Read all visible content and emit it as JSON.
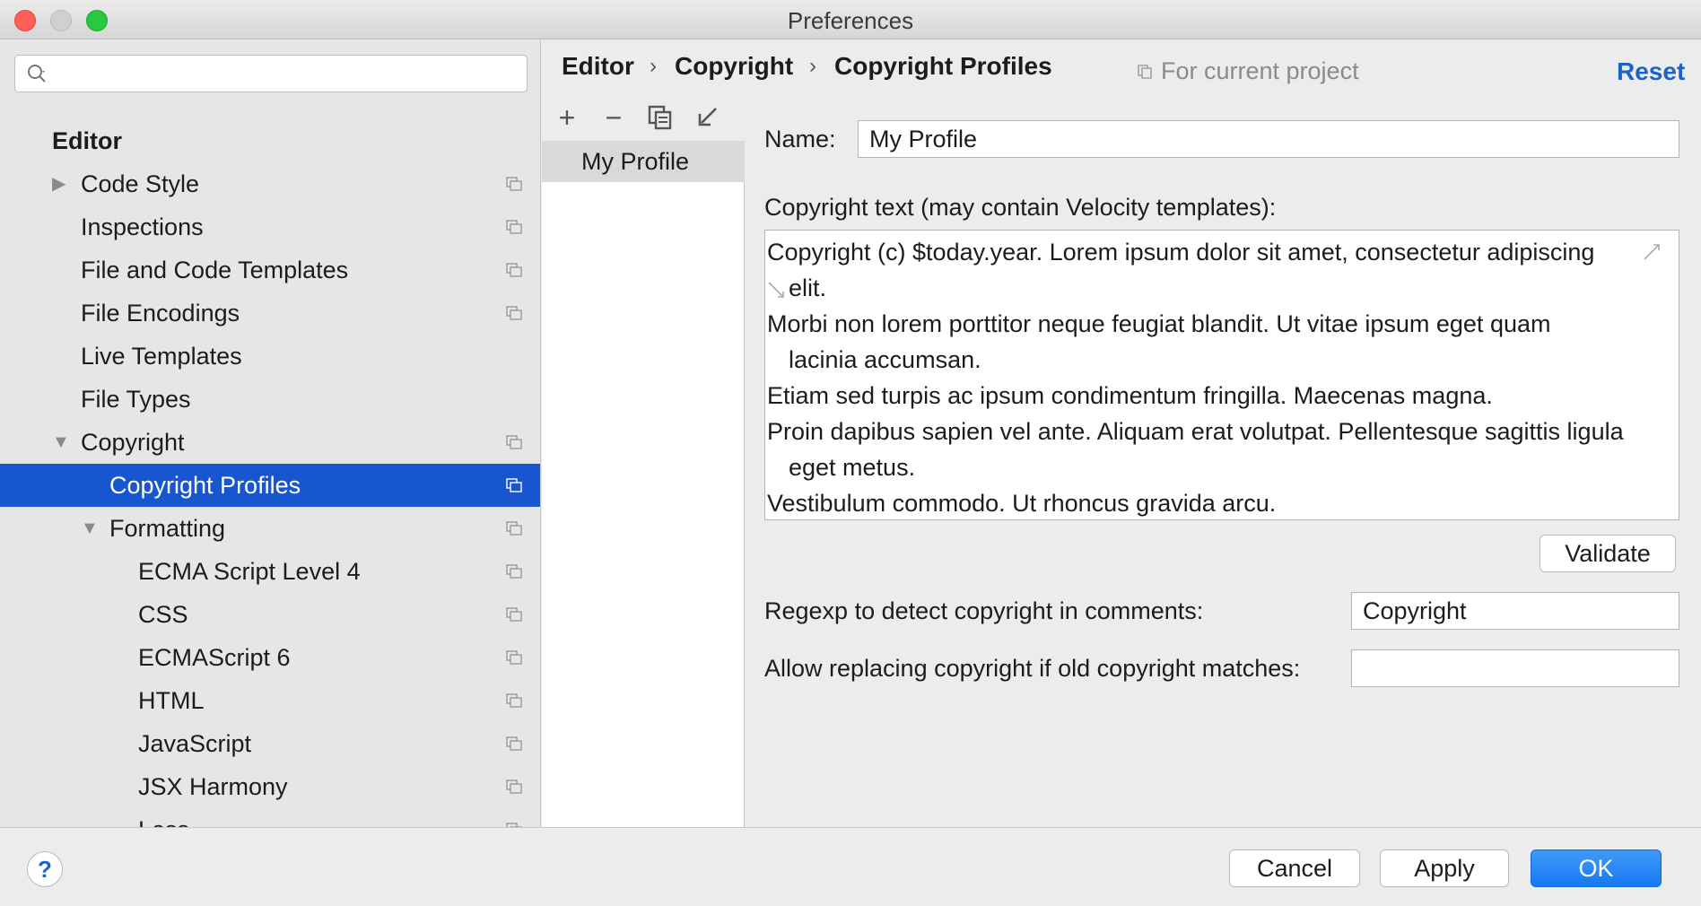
{
  "window": {
    "title": "Preferences"
  },
  "sidebar": {
    "search_placeholder": "",
    "items": [
      {
        "label": "Editor",
        "level": 0,
        "header": true,
        "arrow": "",
        "copy": false
      },
      {
        "label": "Code Style",
        "level": 1,
        "arrow": "▶",
        "copy": true
      },
      {
        "label": "Inspections",
        "level": 1,
        "arrow": "",
        "copy": true
      },
      {
        "label": "File and Code Templates",
        "level": 1,
        "arrow": "",
        "copy": true
      },
      {
        "label": "File Encodings",
        "level": 1,
        "arrow": "",
        "copy": true
      },
      {
        "label": "Live Templates",
        "level": 1,
        "arrow": "",
        "copy": false
      },
      {
        "label": "File Types",
        "level": 1,
        "arrow": "",
        "copy": false
      },
      {
        "label": "Copyright",
        "level": 1,
        "arrow": "▼",
        "copy": true
      },
      {
        "label": "Copyright Profiles",
        "level": 2,
        "arrow": "",
        "copy": true,
        "selected": true
      },
      {
        "label": "Formatting",
        "level": 2,
        "arrow": "▼",
        "copy": true
      },
      {
        "label": "ECMA Script Level 4",
        "level": 3,
        "arrow": "",
        "copy": true
      },
      {
        "label": "CSS",
        "level": 3,
        "arrow": "",
        "copy": true
      },
      {
        "label": "ECMAScript 6",
        "level": 3,
        "arrow": "",
        "copy": true
      },
      {
        "label": "HTML",
        "level": 3,
        "arrow": "",
        "copy": true
      },
      {
        "label": "JavaScript",
        "level": 3,
        "arrow": "",
        "copy": true
      },
      {
        "label": "JSX Harmony",
        "level": 3,
        "arrow": "",
        "copy": true
      },
      {
        "label": "Less",
        "level": 3,
        "arrow": "",
        "copy": true
      }
    ]
  },
  "profiles": {
    "toolbar": {
      "add": "+",
      "remove": "−"
    },
    "items": [
      "My Profile"
    ]
  },
  "header": {
    "breadcrumb": [
      "Editor",
      "Copyright",
      "Copyright Profiles"
    ],
    "separator": "›",
    "scope": "For current project",
    "reset": "Reset"
  },
  "form": {
    "name_label": "Name:",
    "name_value": "My Profile",
    "text_label": "Copyright text (may contain Velocity templates):",
    "text_lines": [
      {
        "text": "Copyright (c) $today.year. Lorem ipsum dolor sit amet, consectetur adipiscing",
        "cont": false
      },
      {
        "text": "elit.",
        "cont": true
      },
      {
        "text": "Morbi non lorem porttitor neque feugiat blandit. Ut vitae ipsum eget quam",
        "cont": false
      },
      {
        "text": "lacinia accumsan.",
        "cont": true
      },
      {
        "text": "Etiam sed turpis ac ipsum condimentum fringilla. Maecenas magna.",
        "cont": false
      },
      {
        "text": "Proin dapibus sapien vel ante. Aliquam erat volutpat. Pellentesque sagittis ligula",
        "cont": false
      },
      {
        "text": "eget metus.",
        "cont": true
      },
      {
        "text": "Vestibulum commodo. Ut rhoncus gravida arcu.",
        "cont": false
      }
    ],
    "validate_label": "Validate",
    "regexp_label": "Regexp to detect copyright in comments:",
    "regexp_value": "Copyright",
    "replace_label": "Allow replacing copyright if old copyright matches:",
    "replace_value": ""
  },
  "footer": {
    "help": "?",
    "cancel": "Cancel",
    "apply": "Apply",
    "ok": "OK"
  },
  "colors": {
    "selection": "#1756cf",
    "link": "#1d63c5",
    "primary_button": "#1778f2"
  }
}
